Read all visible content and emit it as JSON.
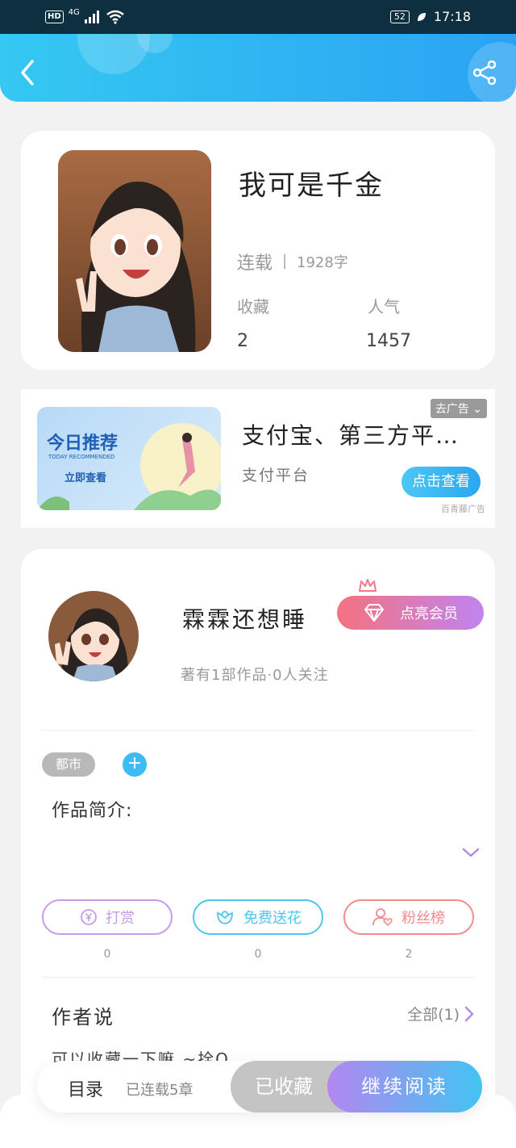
{
  "status_bar": {
    "hd": "HD",
    "network": "4G",
    "battery": "52",
    "time": "17:18"
  },
  "book": {
    "title": "我可是千金",
    "status": "连载",
    "word_count": "1928字",
    "favorites_label": "收藏",
    "favorites_value": "2",
    "popularity_label": "人气",
    "popularity_value": "1457"
  },
  "ad": {
    "image_title": "今日推荐",
    "image_subtitle": "TODAY RECOMMENDED",
    "image_button": "立即查看",
    "title": "支付宝、第三方平…",
    "subtitle": "支付平台",
    "close_label": "去广告",
    "button_label": "点击查看",
    "source": "百青藤广告"
  },
  "author": {
    "name": "霖霖还想睡",
    "vip_label": "点亮会员",
    "works_info": "著有1部作品·0人关注"
  },
  "tags": {
    "category": "都市",
    "add": "+"
  },
  "intro_label": "作品简介:",
  "actions": [
    {
      "label": "打赏",
      "count": "0",
      "color": "#c79be8"
    },
    {
      "label": "免费送花",
      "count": "0",
      "color": "#4cc7ec"
    },
    {
      "label": "粉丝榜",
      "count": "2",
      "color": "#f28c8c"
    }
  ],
  "author_says": {
    "title": "作者说",
    "all_label": "全部(1)",
    "text": "可以收藏一下嘛 ~拴Q"
  },
  "bottom_bar": {
    "catalog": "目录",
    "chapters": "已连载5章",
    "collected": "已收藏",
    "read": "继续阅读"
  }
}
